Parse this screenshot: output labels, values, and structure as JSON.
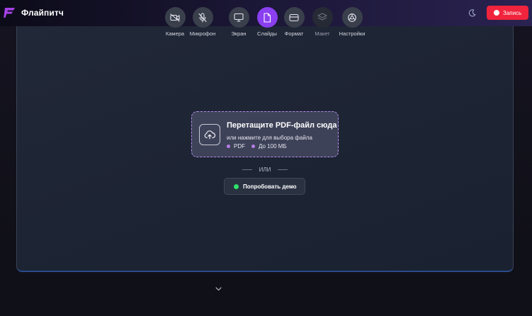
{
  "header": {
    "app_title": "Флайпитч",
    "record_label": "Запись",
    "theme_icon": "moon-icon",
    "brand_color": "#a541e8",
    "record_color": "#f0243c"
  },
  "dropzone": {
    "title": "Перетащите PDF-файл сюда",
    "subtitle": "или нажмите для выбора файла",
    "format": "PDF",
    "max_size": "До 100 МБ",
    "icon": "cloud-upload-icon"
  },
  "divider": {
    "text": "ИЛИ"
  },
  "demo": {
    "label": "Попробовать демо",
    "dot_color": "#2ee06a"
  },
  "toolbar": {
    "items": [
      {
        "label": "Камера",
        "icon": "camera-off-icon"
      },
      {
        "label": "Микрофон",
        "icon": "mic-off-icon"
      },
      {
        "label": "Экран",
        "icon": "monitor-icon"
      },
      {
        "label": "Слайды",
        "icon": "file-icon",
        "active": true
      },
      {
        "label": "Формат",
        "icon": "layout-icon"
      },
      {
        "label": "Макет",
        "icon": "layers-icon",
        "disabled": true
      },
      {
        "label": "Настройки",
        "icon": "settings-icon"
      }
    ]
  }
}
